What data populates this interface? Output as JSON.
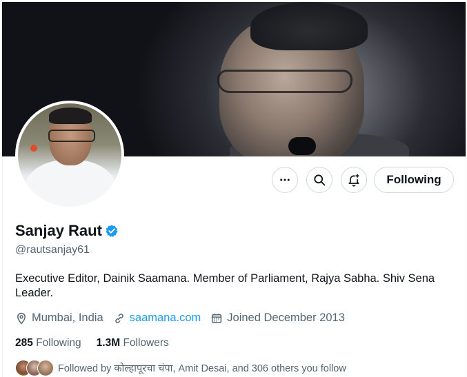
{
  "profile": {
    "name": "Sanjay Raut",
    "handle": "@rautsanjay61",
    "bio": "Executive Editor, Dainik Saamana. Member of Parliament, Rajya Sabha. Shiv Sena Leader.",
    "location": "Mumbai, India",
    "website": "saamana.com",
    "joined": "Joined December 2013",
    "following_count": "285",
    "following_label": "Following",
    "followers_count": "1.3M",
    "followers_label": "Followers",
    "followed_by": "Followed by कोल्हापूरचा चंपा, Amit Desai, and 306 others you follow",
    "verified": true
  },
  "actions": {
    "more_icon": "more-icon",
    "search_icon": "search-icon",
    "notify_icon": "bell-plus-icon",
    "follow_label": "Following"
  },
  "colors": {
    "accent": "#1d9bf0",
    "text": "#0f1419",
    "secondary": "#536471",
    "border": "#cfd9de"
  }
}
